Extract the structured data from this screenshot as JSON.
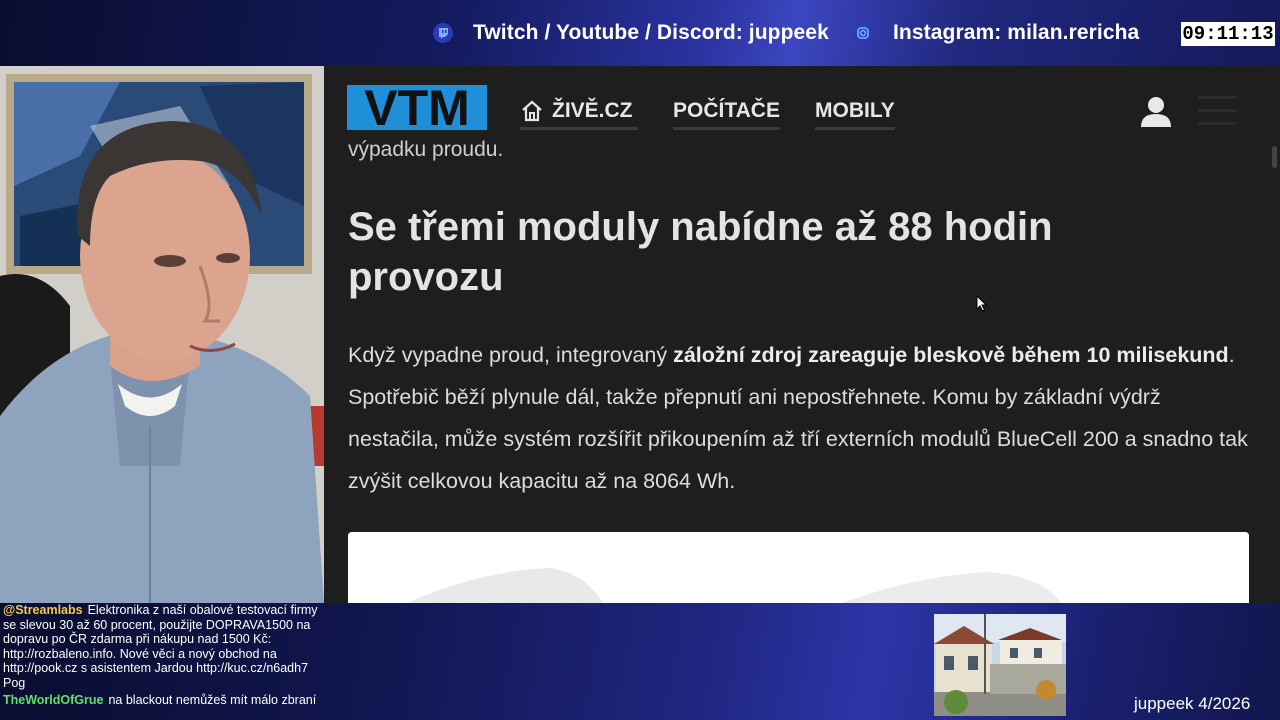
{
  "overlay": {
    "social_twitch": "Twitch / Youtube / Discord: juppeek",
    "social_instagram": "Instagram: milan.rericha",
    "clock": "09:11:13",
    "footer_tag": "juppeek 4/2026"
  },
  "browser": {
    "nav": {
      "logo_text": "VTM",
      "links": [
        "ŽIVĚ.CZ",
        "POČÍTAČE",
        "MOBILY"
      ]
    },
    "article": {
      "prev_line": "výpadku proudu.",
      "heading": "Se třemi moduly nabídne až 88 hodin provozu",
      "para_1": "Když vypadne proud, integrovaný ",
      "para_bold_1": "záložní zdroj zareaguje bleskově během 10 milisekund",
      "para_2": ". Spotřebič běží plynule dál, takže přepnutí ani nepostřehnete. Komu by základní výdrž nestačila, může systém rozšířit přikoupením až tří externích modulů BlueCell 200 a snadno tak zvýšit celkovou kapacitu až na 8064 Wh."
    }
  },
  "chat": [
    {
      "user": "@Streamlabs",
      "text": "Elektronika z naší obalové testovací firmy se slevou 30 až 60 procent, použijte DOPRAVA1500 na dopravu po ČR zdarma při nákupu nad 1500 Kč: http://rozbaleno.info. Nové věci a nový obchod na http://pook.cz s asistentem Jardou http://kuc.cz/n6adh7 Pog"
    },
    {
      "user": "TheWorldOfGrue",
      "text": "na blackout nemůžeš mít málo zbraní"
    }
  ],
  "colors": {
    "logo_blue": "#1f8fd8",
    "page_bg": "#1e1e1f",
    "overlay_blue": "#2c35a8"
  }
}
